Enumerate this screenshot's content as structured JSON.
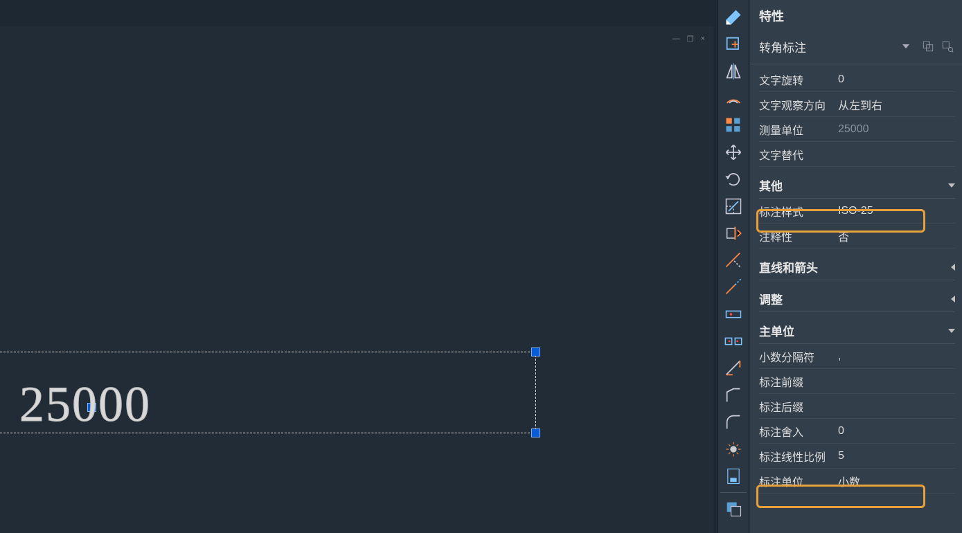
{
  "canvas": {
    "dimension_text": "25000"
  },
  "properties": {
    "title": "特性",
    "selected_type": "转角标注",
    "rows": {
      "text_rotation": {
        "label": "文字旋转",
        "value": "0"
      },
      "text_direction": {
        "label": "文字观察方向",
        "value": "从左到右"
      },
      "measure_unit": {
        "label": "测量单位",
        "value": "25000"
      },
      "text_override": {
        "label": "文字替代",
        "value": ""
      }
    },
    "sections": {
      "other": "其他",
      "lines_arrows": "直线和箭头",
      "fit": "调整",
      "primary_units": "主单位"
    },
    "other": {
      "dim_style": {
        "label": "标注样式",
        "value": "ISO-25"
      },
      "annotative": {
        "label": "注释性",
        "value": "否"
      }
    },
    "primary": {
      "decimal_sep": {
        "label": "小数分隔符",
        "value": ","
      },
      "dim_prefix": {
        "label": "标注前缀",
        "value": ""
      },
      "dim_suffix": {
        "label": "标注后缀",
        "value": ""
      },
      "dim_round": {
        "label": "标注舍入",
        "value": "0"
      },
      "dim_scale_linear": {
        "label": "标注线性比例",
        "value": "5"
      },
      "dim_units": {
        "label": "标注单位",
        "value": "小数"
      }
    }
  }
}
